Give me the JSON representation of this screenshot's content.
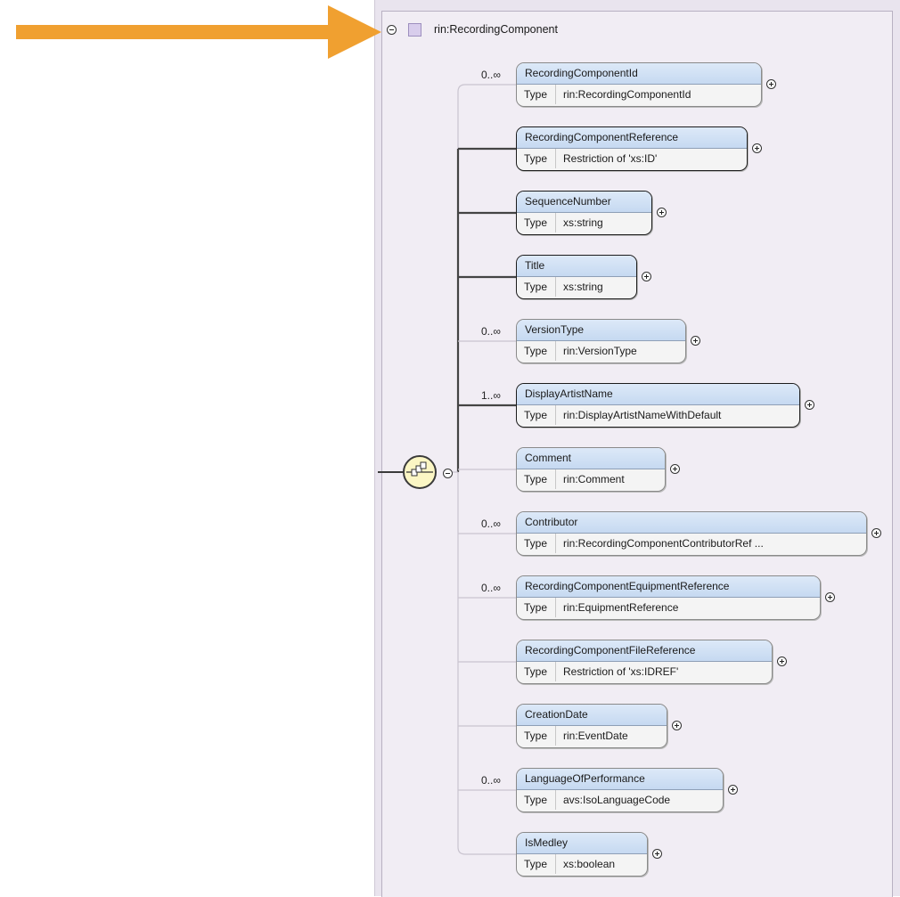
{
  "colors": {
    "arrow": "#f0a030",
    "element_header": "#c6d9f1",
    "panel_background": "#f1edf4",
    "sequence_fill": "#fbf6c4"
  },
  "root": {
    "name": "rin:RecordingComponent",
    "icon": "complex-type-square-icon"
  },
  "type_key": "Type",
  "elements": [
    {
      "name": "RecordingComponentId",
      "type": "rin:RecordingComponentId",
      "cardinality": "0..∞",
      "required": false
    },
    {
      "name": "RecordingComponentReference",
      "type": "Restriction of 'xs:ID'",
      "cardinality": "",
      "required": true
    },
    {
      "name": "SequenceNumber",
      "type": "xs:string",
      "cardinality": "",
      "required": true
    },
    {
      "name": "Title",
      "type": "xs:string",
      "cardinality": "",
      "required": true
    },
    {
      "name": "VersionType",
      "type": "rin:VersionType",
      "cardinality": "0..∞",
      "required": false
    },
    {
      "name": "DisplayArtistName",
      "type": "rin:DisplayArtistNameWithDefault",
      "cardinality": "1..∞",
      "required": true
    },
    {
      "name": "Comment",
      "type": "rin:Comment",
      "cardinality": "",
      "required": false
    },
    {
      "name": "Contributor",
      "type": "rin:RecordingComponentContributorRef ...",
      "cardinality": "0..∞",
      "required": false
    },
    {
      "name": "RecordingComponentEquipmentReference",
      "type": "rin:EquipmentReference",
      "cardinality": "0..∞",
      "required": false
    },
    {
      "name": "RecordingComponentFileReference",
      "type": "Restriction of 'xs:IDREF'",
      "cardinality": "",
      "required": false
    },
    {
      "name": "CreationDate",
      "type": "rin:EventDate",
      "cardinality": "",
      "required": false
    },
    {
      "name": "LanguageOfPerformance",
      "type": "avs:IsoLanguageCode",
      "cardinality": "0..∞",
      "required": false
    },
    {
      "name": "IsMedley",
      "type": "xs:boolean",
      "cardinality": "",
      "required": false
    }
  ]
}
